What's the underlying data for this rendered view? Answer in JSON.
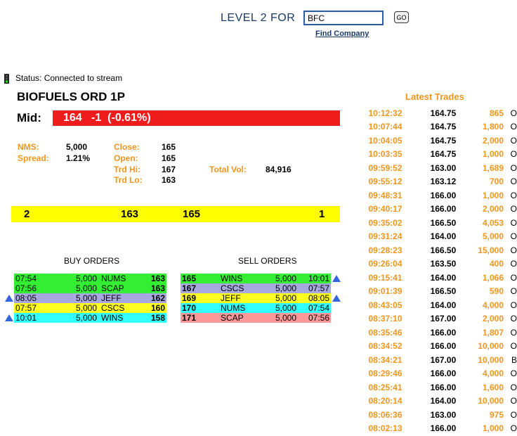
{
  "header": {
    "title": "LEVEL 2 FOR",
    "symbol_value": "BFC",
    "go_label": "GO",
    "find_link": "Find Company"
  },
  "status": {
    "text": "Status: Connected to stream"
  },
  "quote": {
    "company": "BIOFUELS ORD 1P",
    "mid_label": "Mid:",
    "mid_price": "164",
    "mid_change": "-1",
    "mid_pct": "(-0.61%)",
    "nms_label": "NMS:",
    "nms": "5,000",
    "spread_label": "Spread:",
    "spread": "1.21%",
    "close_label": "Close:",
    "close": "165",
    "open_label": "Open:",
    "open": "165",
    "trdhi_label": "Trd Hi:",
    "trdhi": "167",
    "trdlo_label": "Trd Lo:",
    "trdlo": "163",
    "totvol_label": "Total Vol:",
    "totvol": "84,916"
  },
  "bidask": {
    "bid_count": "2",
    "bid": "163",
    "ask": "165",
    "ask_count": "1"
  },
  "buy_orders": {
    "title": "BUY ORDERS",
    "rows": [
      {
        "time": "07:54",
        "size": "5,000",
        "mm": "NUMS",
        "price": "163",
        "color": "#33ee33",
        "arrow": false
      },
      {
        "time": "07:56",
        "size": "5,000",
        "mm": "SCAP",
        "price": "163",
        "color": "#33ee33",
        "arrow": false
      },
      {
        "time": "08:05",
        "size": "5,000",
        "mm": "JEFF",
        "price": "162",
        "color": "#a8a8e0",
        "arrow": true
      },
      {
        "time": "07:57",
        "size": "5,000",
        "mm": "CSCS",
        "price": "160",
        "color": "#ffff22",
        "arrow": false
      },
      {
        "time": "10:01",
        "size": "5,000",
        "mm": "WINS",
        "price": "158",
        "color": "#33ffff",
        "arrow": true
      }
    ]
  },
  "sell_orders": {
    "title": "SELL ORDERS",
    "rows": [
      {
        "price": "165",
        "mm": "WINS",
        "size": "5,000",
        "time": "10:01",
        "color": "#33ee33",
        "arrow": true
      },
      {
        "price": "167",
        "mm": "CSCS",
        "size": "5,000",
        "time": "07:57",
        "color": "#a8a8e0",
        "arrow": false
      },
      {
        "price": "169",
        "mm": "JEFF",
        "size": "5,000",
        "time": "08:05",
        "color": "#ffff22",
        "arrow": true
      },
      {
        "price": "170",
        "mm": "NUMS",
        "size": "5,000",
        "time": "07:54",
        "color": "#33ffff",
        "arrow": false
      },
      {
        "price": "171",
        "mm": "SCAP",
        "size": "5,000",
        "time": "07:56",
        "color": "#ff9999",
        "arrow": false
      }
    ]
  },
  "latest_trades": {
    "title": "Latest Trades",
    "rows": [
      {
        "time": "10:12:32",
        "price": "164.75",
        "size": "865",
        "type": "O"
      },
      {
        "time": "10:07:44",
        "price": "164.75",
        "size": "1,800",
        "type": "O"
      },
      {
        "time": "10:04:05",
        "price": "164.75",
        "size": "2,000",
        "type": "O"
      },
      {
        "time": "10:03:35",
        "price": "164.75",
        "size": "1,000",
        "type": "O"
      },
      {
        "time": "09:59:52",
        "price": "163.00",
        "size": "1,689",
        "type": "O"
      },
      {
        "time": "09:55:12",
        "price": "163.12",
        "size": "700",
        "type": "O"
      },
      {
        "time": "09:48:31",
        "price": "166.00",
        "size": "1,000",
        "type": "O"
      },
      {
        "time": "09:40:17",
        "price": "166.00",
        "size": "2,000",
        "type": "O"
      },
      {
        "time": "09:35:02",
        "price": "166.50",
        "size": "4,053",
        "type": "O"
      },
      {
        "time": "09:31:24",
        "price": "164.00",
        "size": "5,000",
        "type": "O"
      },
      {
        "time": "09:28:23",
        "price": "166.50",
        "size": "15,000",
        "type": "O"
      },
      {
        "time": "09:26:04",
        "price": "163.50",
        "size": "400",
        "type": "O"
      },
      {
        "time": "09:15:41",
        "price": "164.00",
        "size": "1,066",
        "type": "O"
      },
      {
        "time": "09:01:39",
        "price": "166.50",
        "size": "590",
        "type": "O"
      },
      {
        "time": "08:43:05",
        "price": "164.00",
        "size": "4,000",
        "type": "O"
      },
      {
        "time": "08:37:10",
        "price": "167.00",
        "size": "2,000",
        "type": "O"
      },
      {
        "time": "08:35:46",
        "price": "166.00",
        "size": "1,807",
        "type": "O"
      },
      {
        "time": "08:34:52",
        "price": "166.00",
        "size": "10,000",
        "type": "O"
      },
      {
        "time": "08:34:21",
        "price": "167.00",
        "size": "10,000",
        "type": "B"
      },
      {
        "time": "08:29:46",
        "price": "166.00",
        "size": "4,000",
        "type": "O"
      },
      {
        "time": "08:25:41",
        "price": "166.00",
        "size": "1,600",
        "type": "O"
      },
      {
        "time": "08:20:14",
        "price": "164.00",
        "size": "10,000",
        "type": "O"
      },
      {
        "time": "08:06:36",
        "price": "163.00",
        "size": "975",
        "type": "O"
      },
      {
        "time": "08:02:13",
        "price": "166.00",
        "size": "1,000",
        "type": "O"
      }
    ]
  }
}
